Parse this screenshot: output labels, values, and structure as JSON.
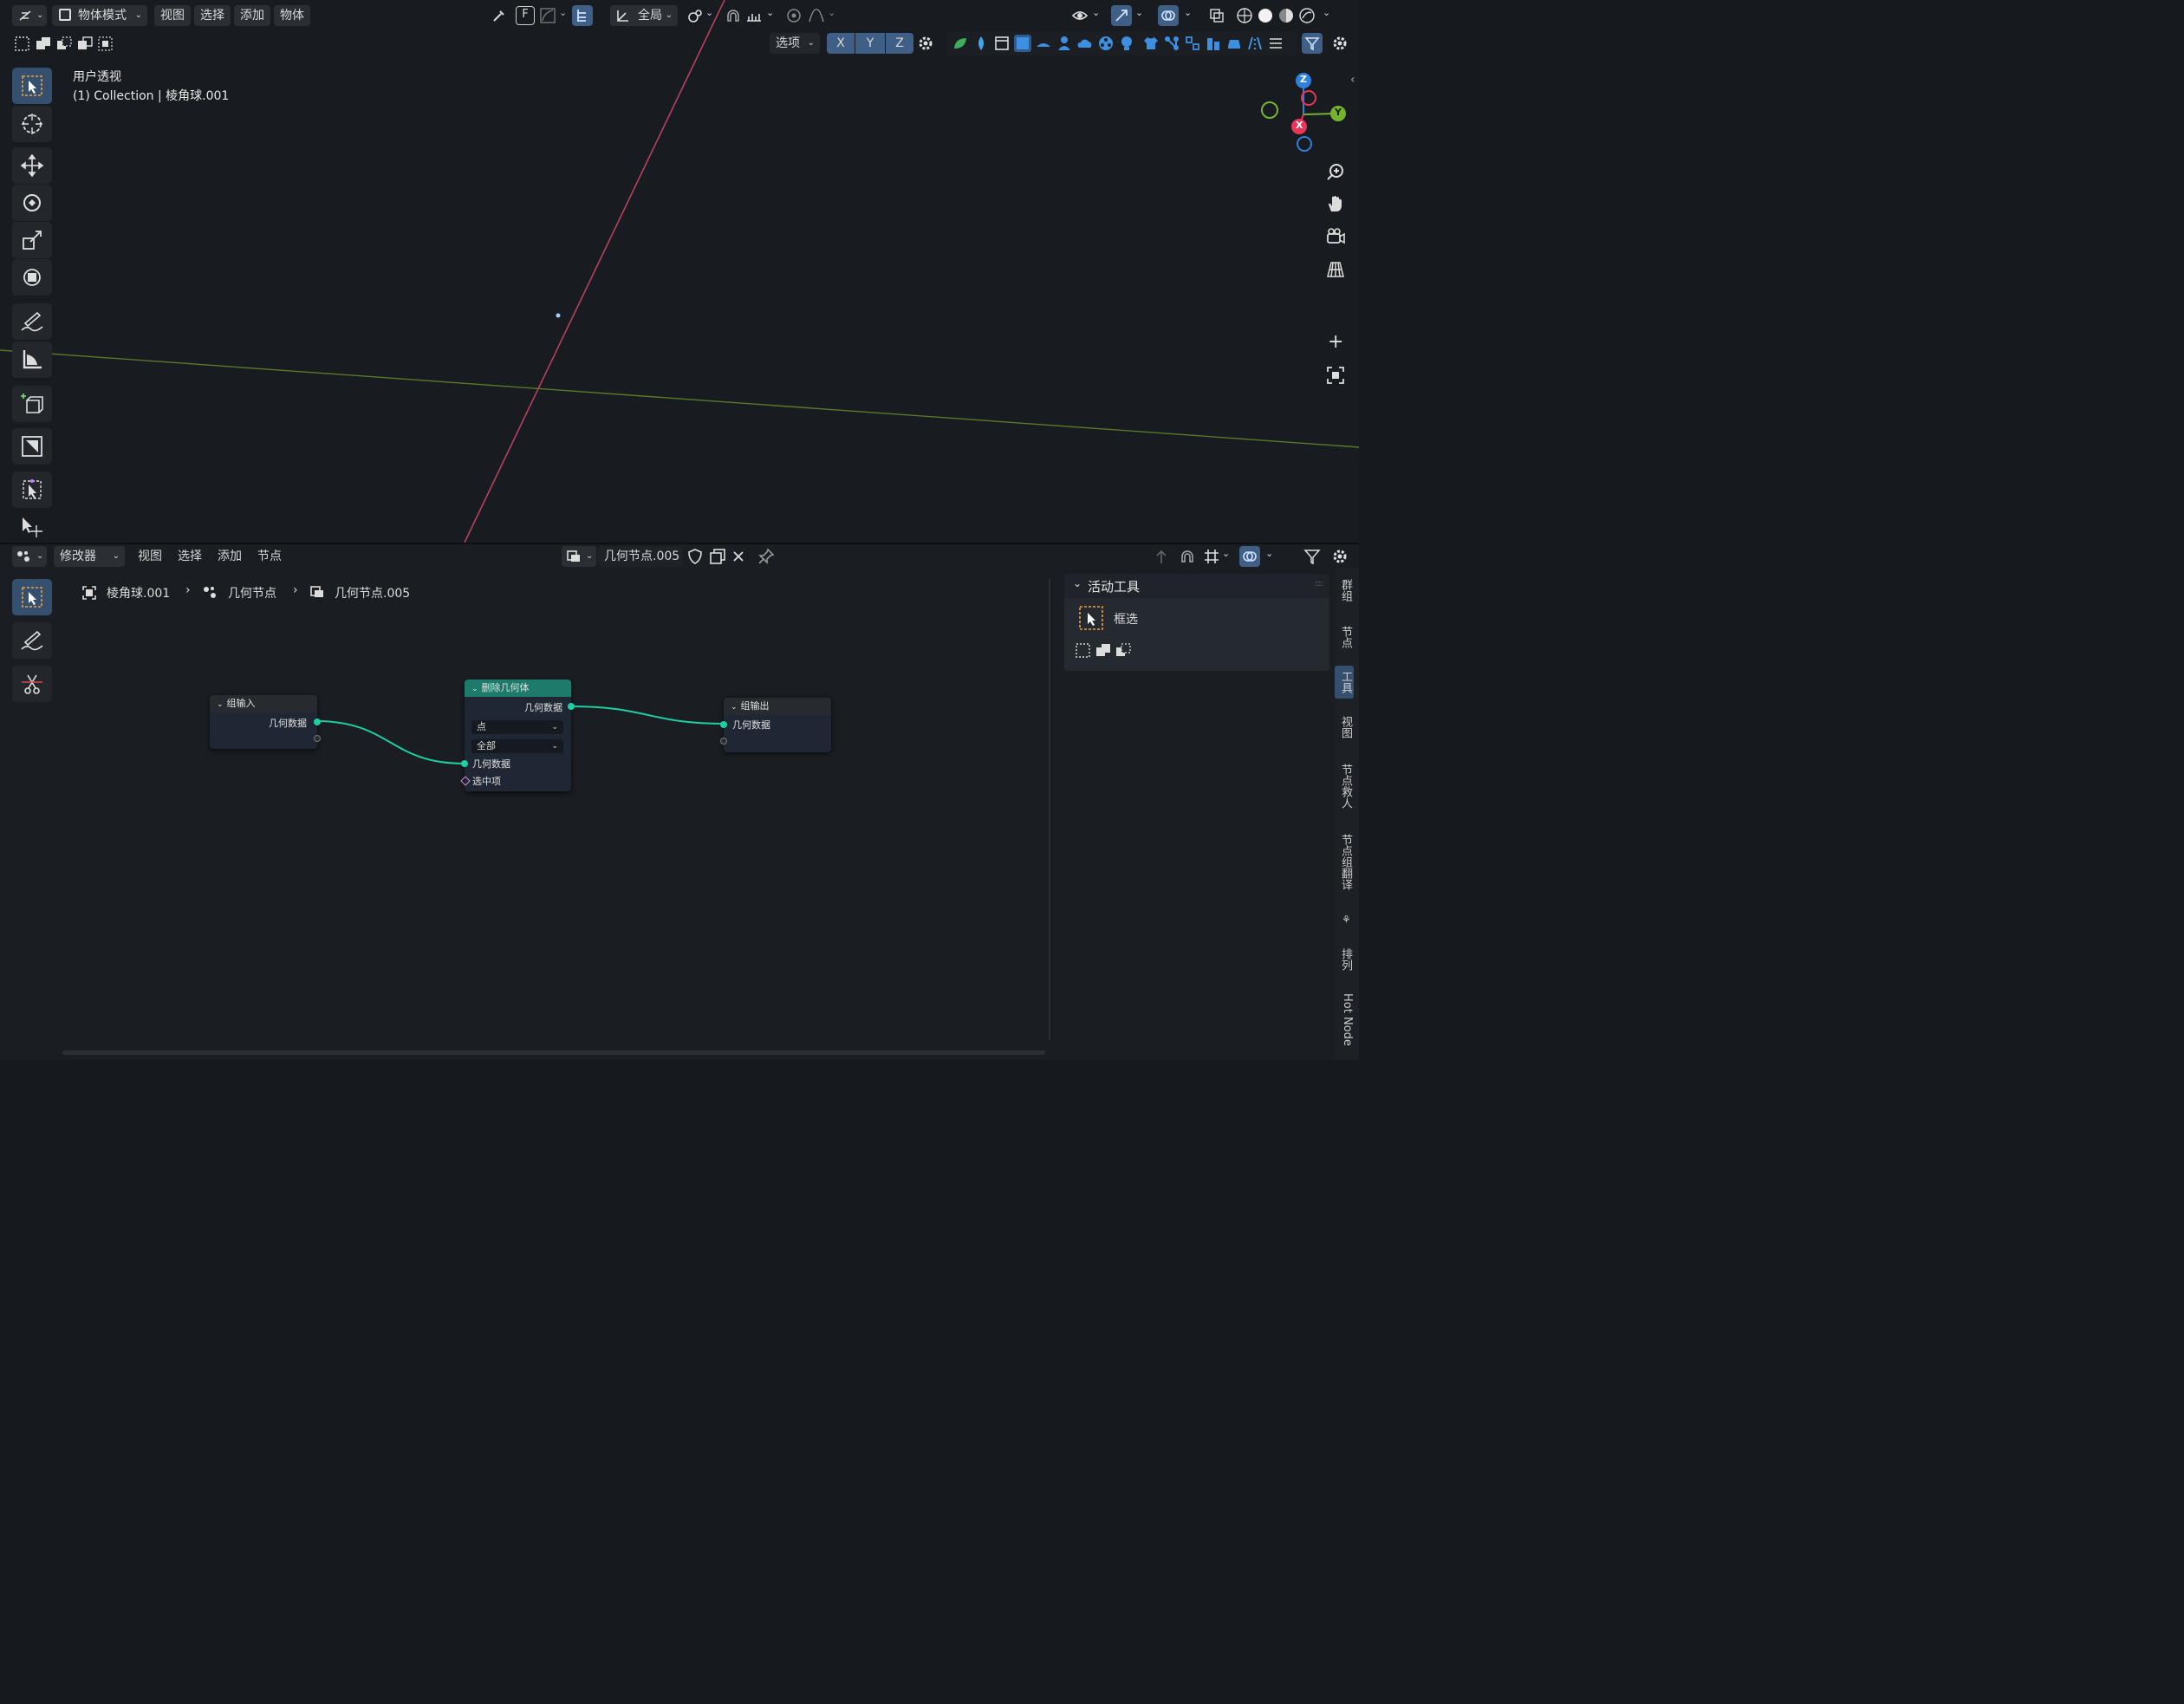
{
  "viewport_header": {
    "mode": "物体模式",
    "menu": [
      "视图",
      "选择",
      "添加",
      "物体"
    ],
    "orientation": "全局",
    "snap_key": "F",
    "options": "选项",
    "axes": [
      "X",
      "Y",
      "Z"
    ]
  },
  "viewport": {
    "view_name": "用户透视",
    "collection_info": "(1) Collection | 棱角球.001",
    "gizmo": {
      "z": "Z",
      "y": "Y",
      "x": "X"
    }
  },
  "node_header": {
    "editor_type": "修改器",
    "menu": [
      "视图",
      "选择",
      "添加",
      "节点"
    ],
    "tree_name": "几何节点.005"
  },
  "breadcrumb": [
    "棱角球.001",
    "几何节点",
    "几何节点.005"
  ],
  "nodes": {
    "group_input": {
      "title": "组输入",
      "output": "几何数据"
    },
    "delete_geometry": {
      "title": "删除几何体",
      "output": "几何数据",
      "domain": "点",
      "mode": "全部",
      "input_geometry": "几何数据",
      "input_selection": "选中项"
    },
    "group_output": {
      "title": "组输出",
      "input": "几何数据"
    }
  },
  "sidebar": {
    "panel_title": "活动工具",
    "tool_name": "框选",
    "tabs": [
      "群组",
      "节点",
      "工具",
      "视图",
      "节点救人",
      "节点组翻译",
      "排列",
      "Hot Node"
    ]
  },
  "colors": {
    "accent": "#3f5f86",
    "x_axis": "#e8365a",
    "y_axis": "#78b330",
    "z_axis": "#2f7fdc",
    "geometry_socket": "#1ecfa3",
    "geometry_node_header": "#1e7a6a"
  }
}
